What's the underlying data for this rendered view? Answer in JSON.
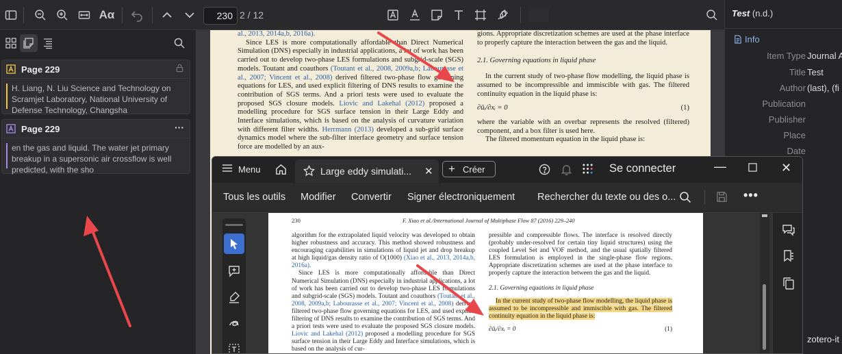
{
  "toolbar": {
    "page_value": "230",
    "page_total": "2 / 12",
    "font_button": "Aα"
  },
  "sidebar": {
    "annotations": [
      {
        "page": "Page 229",
        "color": "#f2c84b",
        "text": "H. Liang, N. Liu Science and Technology on Scramjet Laboratory, National University of Defense Technology, Changsha",
        "right_icon": "lock-icon"
      },
      {
        "page": "Page 229",
        "color": "#a58cf0",
        "text": "en the gas and liquid. The water jet primary breakup in a supersonic air crossflow is well predicted, with the sho",
        "right_icon": "more-icon",
        "right_text": "···"
      }
    ]
  },
  "zotero_pdf": {
    "col1": {
      "line0": "al., 2013, 2014a,b, 2016a).",
      "p1": "Since LES is more computationally affordable than Direct Numerical Simulation (DNS) especially in industrial applications, a lot of work has been carried out to develop two-phase LES formulations and subgrid-scale (SGS) models. Toutant and coauthors",
      "link1": "(Toutant et al., 2008, 2009a,b; Labourasse et al., 2007; Vincent et al., 2008)",
      "p2": "derived filtered two-phase flow governing equations for LES, and used explicit filtering of DNS results to examine the contribution of SGS terms. And a priori tests were used to evaluate the proposed SGS closure models.",
      "link2": "Liovic and Lakehal (2012)",
      "p3": "proposed a modelling procedure for SGS surface tension in their Large Eddy and Interface simulations, which is based on the analysis of curvature variation with different filter widths.",
      "link3": "Herrmann (2013)",
      "p4": "developed a sub-grid surface dynamics model where the sub-filter interface geometry and surface tension force are modelled by an aux-"
    },
    "col2": {
      "p0": "gions. Appropriate discretization schemes are used at the phase interface to properly capture the interaction between the gas and the liquid.",
      "heading": "2.1. Governing equations in liquid phase",
      "p1": "In the current study of two-phase flow modelling, the liquid phase is assumed to be incompressible and immiscible with gas. The filtered continuity equation in the liquid phase is:",
      "eq": "∂ūᵢ/∂xᵢ = 0",
      "eq_num": "(1)",
      "p2": "where the variable with an overbar represents the resolved (filtered) component, and a box filter is used here.",
      "p3": "The filtered momentum equation in the liquid phase is:"
    }
  },
  "item_pane": {
    "title": "Test",
    "title_suffix": "(n.d.)",
    "section": "Info",
    "rows": [
      {
        "key": "Item Type",
        "value": "Journal A"
      },
      {
        "key": "Title",
        "value": "Test"
      },
      {
        "key": "Author",
        "value": "(last), (fi"
      },
      {
        "key": "Publication",
        "value": ""
      },
      {
        "key": "Publisher",
        "value": ""
      },
      {
        "key": "Place",
        "value": ""
      },
      {
        "key": "Date",
        "value": ""
      }
    ],
    "footer": "zotero-it"
  },
  "acrobat": {
    "menu_label": "Menu",
    "tab_title": "Large eddy simulati...",
    "create_label": "Créer",
    "signin": "Se connecter",
    "menu": [
      "Tous les outils",
      "Modifier",
      "Convertir",
      "Signer électroniquement",
      "Rechercher du texte ou des o..."
    ],
    "page": {
      "number": "230",
      "header": "F. Xiao et al./International Journal of Multiphase Flow 87 (2016) 229–240",
      "col1_a": "algorithm for the extrapolated liquid velocity was developed to obtain higher robustness and accuracy. This method showed robustness and encouraging capabilities in simulations of liquid jet and drop breakup at high liquid/gas density ratio of O(1000)",
      "col1_link0": "(Xiao et al., 2013, 2014a,b, 2016a).",
      "col1_b": "Since LES is more computationally affordable than Direct Numerical Simulation (DNS) especially in industrial applications, a lot of work has been carried out to develop two-phase LES formulations and subgrid-scale (SGS) models. Toutant and coauthors",
      "col1_link1": "(Toutant et al., 2008, 2009a,b; Labourasse et al., 2007; Vincent et al., 2008)",
      "col1_c": "derived filtered two-phase flow governing equations for LES, and used explicit filtering of DNS results to examine the contribution of SGS terms. And a priori tests were used to evaluate the proposed SGS closure models.",
      "col1_link2": "Liovic and Lakehal (2012)",
      "col1_d": "proposed a modelling procedure for SGS surface tension in their Large Eddy and Interface simulations, which is based on the analysis of cur-",
      "col2_a": "pressible and compressible flows. The interface is resolved directly (probably under-resolved for certain tiny liquid structures) using the coupled Level Set and VOF method, and the usual spatially filtered LES formulation is employed in the single-phase flow regions. Appropriate discretization schemes are used at the phase interface to properly capture the interaction between the gas and the liquid.",
      "col2_heading": "2.1. Governing equations in liquid phase",
      "col2_hl": "In the current study of two-phase flow modelling, the liquid phase is assumed to be incompressible and immiscible with gas. The filtered continuity equation in the liquid phase is:",
      "col2_eq": "∂ūᵢ/∂xᵢ = 0",
      "col2_eqnum": "(1)"
    }
  },
  "colors": {
    "accent": "#3d6fd1",
    "arrow": "#e8474b",
    "highlight": "#f6d785",
    "page_bg": "#f3ecd8"
  }
}
